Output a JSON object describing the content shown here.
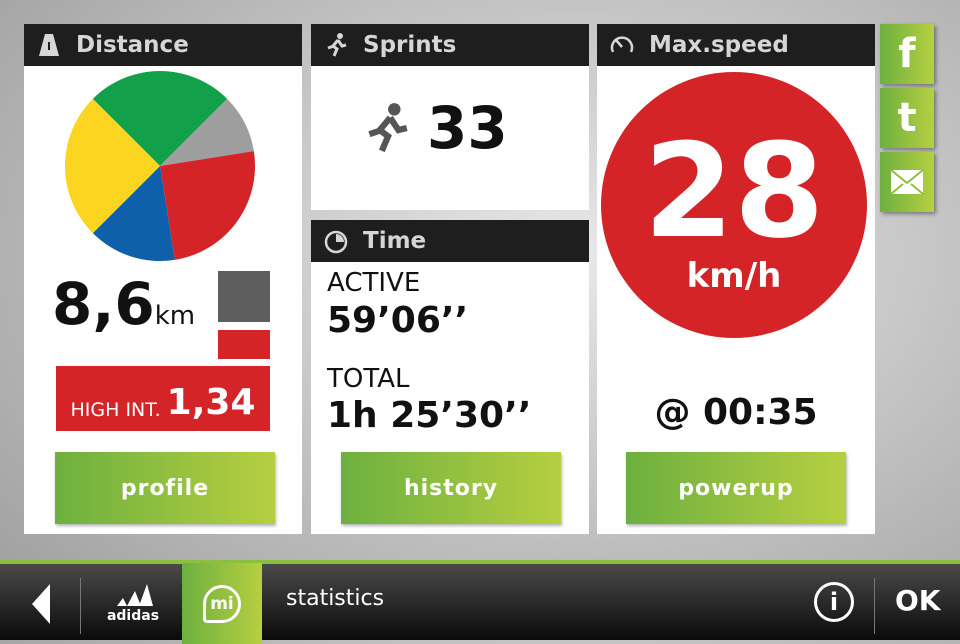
{
  "distance": {
    "title": "Distance",
    "value": "8,6",
    "unit": "km",
    "high_int_label": "HIGH INT.",
    "high_int_value": "1,34",
    "button": "profile",
    "chart_data": {
      "type": "pie",
      "slices": [
        {
          "color": "#12a14a",
          "value": 25
        },
        {
          "color": "#9e9e9e",
          "value": 10
        },
        {
          "color": "#d42428",
          "value": 25
        },
        {
          "color": "#0e60aa",
          "value": 15
        },
        {
          "color": "#fbd520",
          "value": 25
        }
      ]
    },
    "legend_colors": [
      "#5e5e5e",
      "#d42428"
    ]
  },
  "sprints": {
    "title": "Sprints",
    "count": "33"
  },
  "time": {
    "title": "Time",
    "active_label": "ACTIVE",
    "active_value": "59’06’’",
    "total_label": "TOTAL",
    "total_value": "1h 25’30’’",
    "button": "history"
  },
  "maxspeed": {
    "title": "Max.speed",
    "value": "28",
    "unit": "km/h",
    "at": "@ 00:35",
    "button": "powerup"
  },
  "social": [
    "facebook",
    "twitter",
    "email"
  ],
  "bottom": {
    "brand": "adidas",
    "mi": "mi",
    "screen": "statistics",
    "ok": "OK"
  }
}
